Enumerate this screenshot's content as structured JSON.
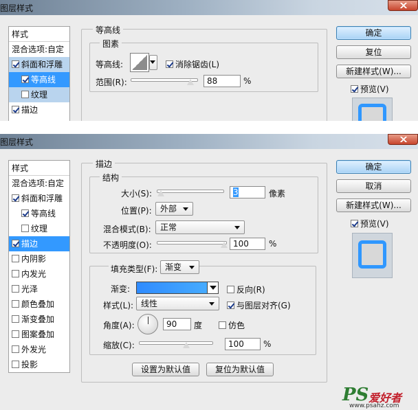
{
  "top": {
    "title": "图层样式",
    "styles_header": "样式",
    "styles_items": [
      {
        "label": "混合选项:自定",
        "checkbox": false
      },
      {
        "label": "斜面和浮雕",
        "checked": true
      },
      {
        "label": "等高线",
        "checked": true
      },
      {
        "label": "纹理",
        "checked": false
      },
      {
        "label": "描边",
        "checked": true
      }
    ],
    "group_title": "等高线",
    "sub_title": "图素",
    "contour_label": "等高线:",
    "antialias_label": "消除锯齿(L)",
    "range_label": "范围(R):",
    "range_value": "88",
    "range_unit": "%",
    "range_fraction": 0.88,
    "buttons": {
      "ok": "确定",
      "reset": "复位",
      "new_style": "新建样式(W)..."
    },
    "preview_label": "预览(V)"
  },
  "bottom": {
    "title": "图层样式",
    "styles_header": "样式",
    "styles_items": [
      {
        "label": "混合选项:自定",
        "checkbox": false
      },
      {
        "label": "斜面和浮雕",
        "checked": true
      },
      {
        "label": "等高线",
        "checked": true
      },
      {
        "label": "纹理",
        "checked": false
      },
      {
        "label": "描边",
        "checked": true
      },
      {
        "label": "内阴影",
        "checked": false
      },
      {
        "label": "内发光",
        "checked": false
      },
      {
        "label": "光泽",
        "checked": false
      },
      {
        "label": "颜色叠加",
        "checked": false
      },
      {
        "label": "渐变叠加",
        "checked": false
      },
      {
        "label": "图案叠加",
        "checked": false
      },
      {
        "label": "外发光",
        "checked": false
      },
      {
        "label": "投影",
        "checked": false
      }
    ],
    "group_title": "描边",
    "structure_title": "结构",
    "size_label": "大小(S):",
    "size_value": "3",
    "size_unit": "像素",
    "position_label": "位置(P):",
    "position_value": "外部",
    "blend_label": "混合模式(B):",
    "blend_value": "正常",
    "opacity_label": "不透明度(O):",
    "opacity_value": "100",
    "opacity_unit": "%",
    "fill_type_label": "填充类型(F):",
    "fill_type_value": "渐变",
    "gradient_label": "渐变:",
    "reverse_label": "反向(R)",
    "style_label": "样式(L):",
    "style_value": "线性",
    "align_label": "与图层对齐(G)",
    "angle_label": "角度(A):",
    "angle_value": "90",
    "angle_unit": "度",
    "dither_label": "仿色",
    "scale_label": "缩放(C):",
    "scale_value": "100",
    "scale_unit": "%",
    "set_default": "设置为默认值",
    "reset_default": "复位为默认值",
    "buttons": {
      "ok": "确定",
      "cancel": "取消",
      "new_style": "新建样式(W)..."
    },
    "preview_label": "预览(V)"
  },
  "watermark": {
    "brand": "PS",
    "cn": "爱好者",
    "url": "www.psahz.com"
  },
  "colors": {
    "accent": "#3399ff",
    "stroke_preview": "#2f97ff",
    "gradient_start": "#2f8bff",
    "gradient_end": "#4ab0ff"
  }
}
